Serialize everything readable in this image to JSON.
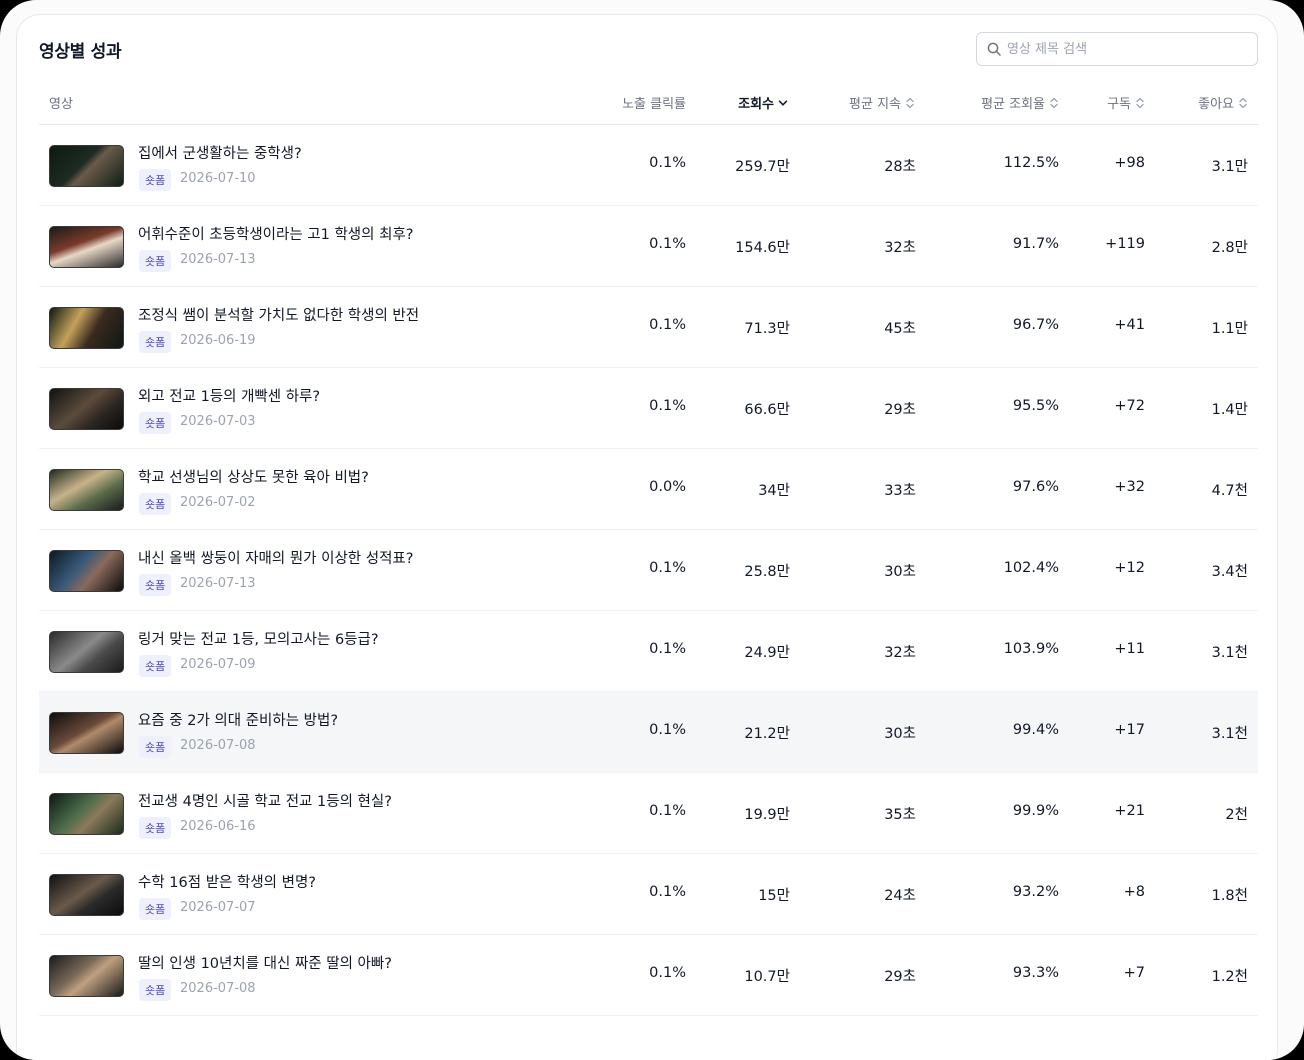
{
  "card": {
    "title": "영상별 성과"
  },
  "search": {
    "placeholder": "영상 제목 검색"
  },
  "columns": {
    "video": "영상",
    "ctr": "노출 클릭률",
    "views": "조회수",
    "avg_duration": "평균 지속",
    "avg_view_rate": "평균 조회율",
    "subs": "구독",
    "likes": "좋아요"
  },
  "sort": {
    "active_column": "views",
    "direction": "desc"
  },
  "badge_label": "숏폼",
  "rows": [
    {
      "title": "집에서 군생활하는 중학생?",
      "badge": "숏폼",
      "date": "2026-07-10",
      "ctr": "0.1%",
      "views": "259.7만",
      "avg_duration": "28초",
      "avg_view_rate": "112.5%",
      "subs": "+98",
      "likes": "3.1만"
    },
    {
      "title": "어휘수준이 초등학생이라는 고1 학생의 최후?",
      "badge": "숏폼",
      "date": "2026-07-13",
      "ctr": "0.1%",
      "views": "154.6만",
      "avg_duration": "32초",
      "avg_view_rate": "91.7%",
      "subs": "+119",
      "likes": "2.8만"
    },
    {
      "title": "조정식 쌤이 분석할 가치도 없다한 학생의 반전",
      "badge": "숏폼",
      "date": "2026-06-19",
      "ctr": "0.1%",
      "views": "71.3만",
      "avg_duration": "45초",
      "avg_view_rate": "96.7%",
      "subs": "+41",
      "likes": "1.1만"
    },
    {
      "title": "외고 전교 1등의 개빡센 하루?",
      "badge": "숏폼",
      "date": "2026-07-03",
      "ctr": "0.1%",
      "views": "66.6만",
      "avg_duration": "29초",
      "avg_view_rate": "95.5%",
      "subs": "+72",
      "likes": "1.4만"
    },
    {
      "title": "학교 선생님의 상상도 못한 육아 비법?",
      "badge": "숏폼",
      "date": "2026-07-02",
      "ctr": "0.0%",
      "views": "34만",
      "avg_duration": "33초",
      "avg_view_rate": "97.6%",
      "subs": "+32",
      "likes": "4.7천"
    },
    {
      "title": "내신 올백 쌍둥이 자매의 뭔가 이상한 성적표?",
      "badge": "숏폼",
      "date": "2026-07-13",
      "ctr": "0.1%",
      "views": "25.8만",
      "avg_duration": "30초",
      "avg_view_rate": "102.4%",
      "subs": "+12",
      "likes": "3.4천"
    },
    {
      "title": "링거 맞는 전교 1등, 모의고사는 6등급?",
      "badge": "숏폼",
      "date": "2026-07-09",
      "ctr": "0.1%",
      "views": "24.9만",
      "avg_duration": "32초",
      "avg_view_rate": "103.9%",
      "subs": "+11",
      "likes": "3.1천"
    },
    {
      "title": "요즘 중 2가 의대 준비하는 방법?",
      "badge": "숏폼",
      "date": "2026-07-08",
      "ctr": "0.1%",
      "views": "21.2만",
      "avg_duration": "30초",
      "avg_view_rate": "99.4%",
      "subs": "+17",
      "likes": "3.1천",
      "highlighted": true
    },
    {
      "title": "전교생 4명인 시골 학교 전교 1등의 현실?",
      "badge": "숏폼",
      "date": "2026-06-16",
      "ctr": "0.1%",
      "views": "19.9만",
      "avg_duration": "35초",
      "avg_view_rate": "99.9%",
      "subs": "+21",
      "likes": "2천"
    },
    {
      "title": "수학 16점 받은 학생의 변명?",
      "badge": "숏폼",
      "date": "2026-07-07",
      "ctr": "0.1%",
      "views": "15만",
      "avg_duration": "24초",
      "avg_view_rate": "93.2%",
      "subs": "+8",
      "likes": "1.8천"
    },
    {
      "title": "딸의 인생 10년치를 대신 짜준 딸의 아빠?",
      "badge": "숏폼",
      "date": "2026-07-08",
      "ctr": "0.1%",
      "views": "10.7만",
      "avg_duration": "29초",
      "avg_view_rate": "93.3%",
      "subs": "+7",
      "likes": "1.2천"
    }
  ],
  "colors": {
    "accent_badge_bg": "#eef0fb",
    "accent_badge_text": "#4f46c7",
    "row_highlight": "#f5f6f8"
  }
}
